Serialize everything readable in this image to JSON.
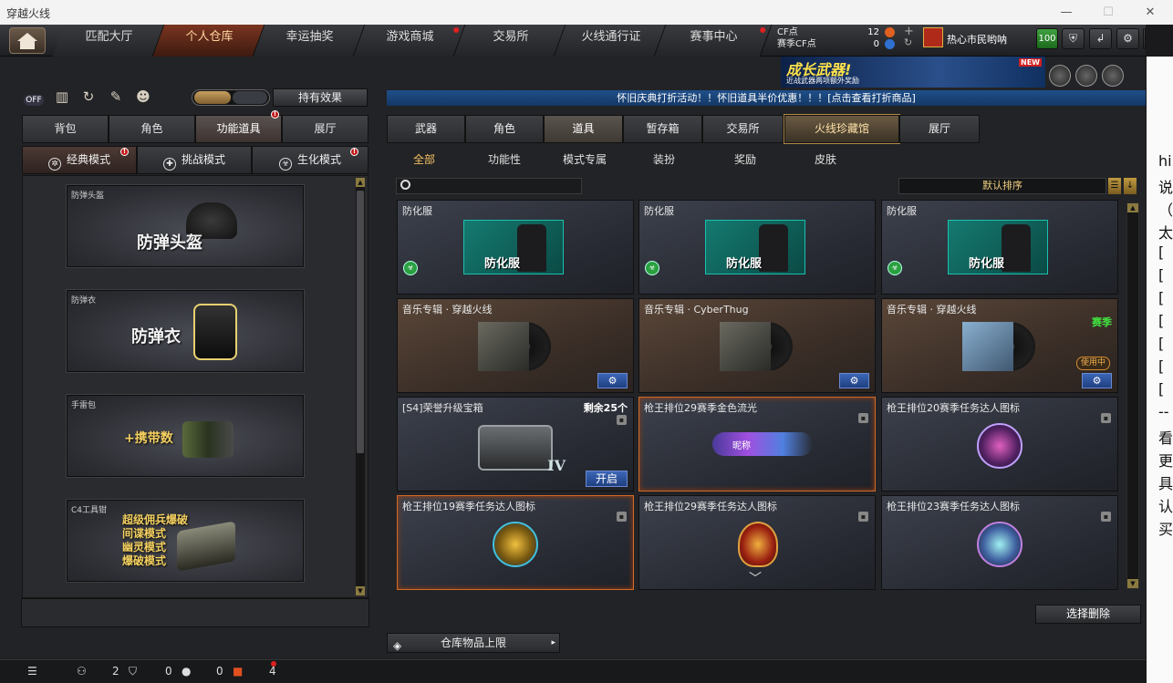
{
  "window": {
    "title": "穿越火线"
  },
  "nav": {
    "tabs": [
      "匹配大厅",
      "个人仓库",
      "幸运抽奖",
      "游戏商城",
      "交易所",
      "火线通行证",
      "赛事中心"
    ],
    "active": "个人仓库"
  },
  "currency": {
    "cf_label": "CF点",
    "cf_value": "12",
    "match_label": "赛季CF点",
    "match_value": "0"
  },
  "user": {
    "name": "热心市民哟呐",
    "level": "100"
  },
  "banner": {
    "title": "成长武器!",
    "subtitle": "近战武器两项额外奖励",
    "tag": "NEW"
  },
  "left": {
    "off_label": "OFF",
    "effect_button": "持有效果",
    "tabs": [
      "背包",
      "角色",
      "功能道具",
      "展厅"
    ],
    "active_tab": "功能道具",
    "modes": [
      "经典模式",
      "挑战模式",
      "生化模式"
    ],
    "items": [
      {
        "caption": "防弹头盔",
        "title": "防弹头盔"
      },
      {
        "caption": "防弹衣",
        "title": "防弹衣"
      },
      {
        "caption": "手雷包",
        "title": "+携带数"
      },
      {
        "caption": "C4工具钳",
        "lines": [
          "超级佣兵爆破",
          "间谍模式",
          "幽灵模式",
          "爆破模式"
        ]
      }
    ]
  },
  "notice": "怀旧庆典打折活动！！怀旧道具半价优惠！！！[点击查看打折商品]",
  "right": {
    "tabs": [
      "武器",
      "角色",
      "道具",
      "暂存箱",
      "交易所",
      "火线珍藏馆",
      "展厅"
    ],
    "active_tab": "道具",
    "subtabs": [
      "全部",
      "功能性",
      "模式专属",
      "装扮",
      "奖励",
      "皮肤"
    ],
    "active_subtab": "全部",
    "search_placeholder": "",
    "sort_label": "默认排序",
    "cards": [
      {
        "name": "防化服",
        "label": "防化服"
      },
      {
        "name": "防化服",
        "label": "防化服"
      },
      {
        "name": "防化服",
        "label": "防化服"
      },
      {
        "name": "音乐专辑 · 穿越火线"
      },
      {
        "name": "音乐专辑 · CyberThug"
      },
      {
        "name": "音乐专辑 · 穿越火线",
        "season": "赛季",
        "in_use": "使用中"
      },
      {
        "name": "[S4]荣誉升级宝箱",
        "remain": "剩余25个",
        "action": "开启",
        "grade": "IV"
      },
      {
        "name": "枪王排位29赛季金色流光",
        "nick": "昵称"
      },
      {
        "name": "枪王排位20赛季任务达人图标"
      },
      {
        "name": "枪王排位19赛季任务达人图标"
      },
      {
        "name": "枪王排位29赛季任务达人图标"
      },
      {
        "name": "枪王排位23赛季任务达人图标"
      }
    ],
    "delete_button": "选择删除",
    "capacity_button": "仓库物品上限"
  },
  "status": {
    "friends": "2",
    "shield": "0",
    "chat": "0",
    "gift": "4"
  },
  "side_text": [
    "hi",
    "说",
    "（",
    "太",
    "[",
    "[",
    "[",
    "[",
    "[",
    "[",
    "[",
    "--",
    "看",
    "更",
    "具",
    "认",
    "买"
  ],
  "colors": {
    "accent": "#d06a28",
    "notice": "#1f4f8a",
    "highlight": "#f4c060"
  }
}
